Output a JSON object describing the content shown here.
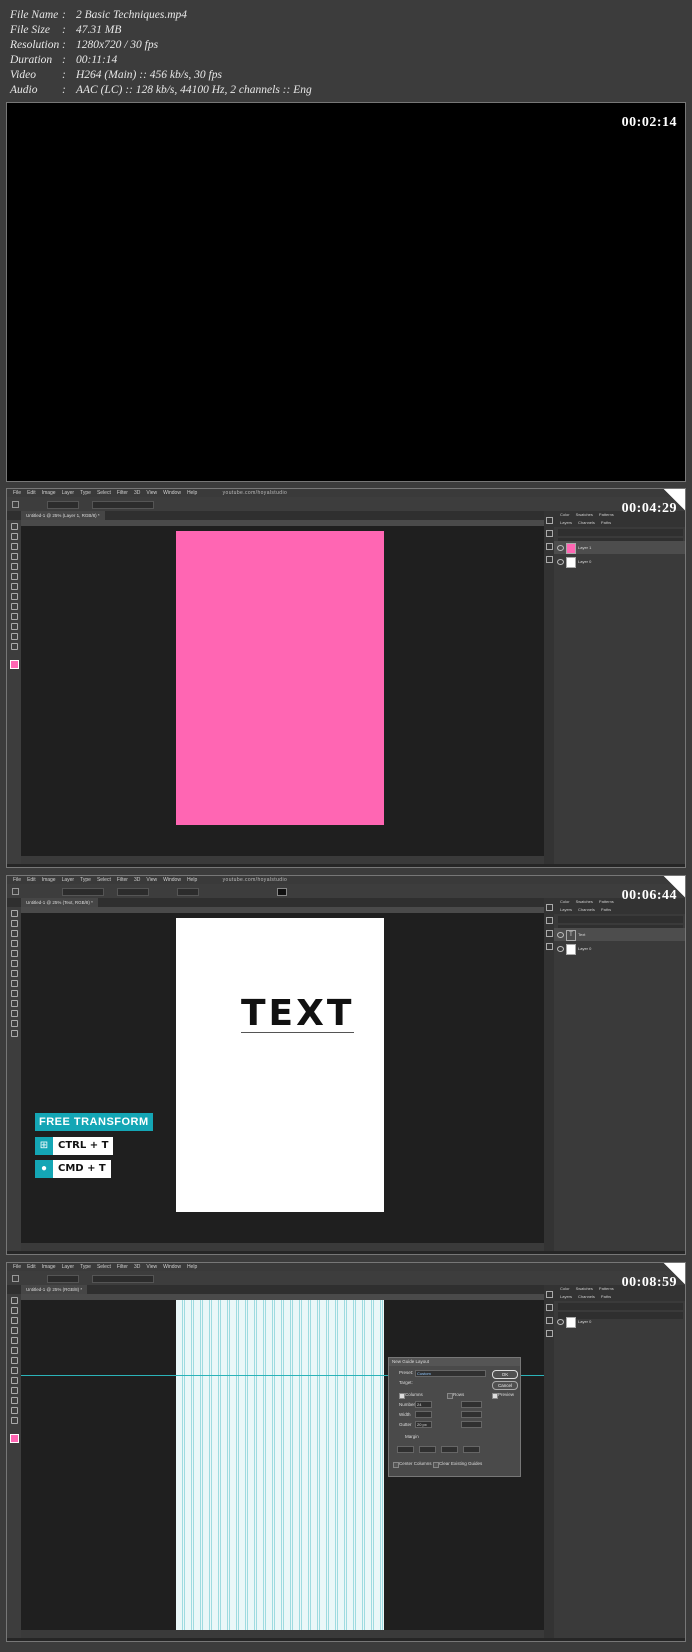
{
  "info": [
    {
      "key": "File Name",
      "value": "2 Basic Techniques.mp4"
    },
    {
      "key": "File Size",
      "value": "47.31 MB"
    },
    {
      "key": "Resolution",
      "value": "1280x720 / 30 fps"
    },
    {
      "key": "Duration",
      "value": "00:11:14"
    },
    {
      "key": "Video",
      "value": "H264 (Main) :: 456 kb/s, 30 fps"
    },
    {
      "key": "Audio",
      "value": "AAC (LC) :: 128 kb/s, 44100 Hz, 2 channels :: Eng"
    }
  ],
  "frames": [
    {
      "timestamp": "00:02:14"
    },
    {
      "timestamp": "00:04:29"
    },
    {
      "timestamp": "00:06:44"
    },
    {
      "timestamp": "00:08:59"
    }
  ],
  "ps": {
    "menu": [
      "File",
      "Edit",
      "Image",
      "Layer",
      "Type",
      "Select",
      "Filter",
      "3D",
      "View",
      "Window",
      "Help"
    ],
    "url": "youtube.com/hoyalstudio",
    "panel_tabs": [
      "Color",
      "Swatches",
      "Patterns"
    ],
    "panel_tabs2": [
      "Layers",
      "Channels",
      "Paths"
    ]
  },
  "frame2": {
    "doc_tab": "Untitled-1 @ 25% (Layer 1, RGB/8) *",
    "layers": [
      "Layer 1",
      "Layer 0"
    ],
    "canvas_color": "#ff66b3"
  },
  "frame3": {
    "doc_tab": "Untitled-1 @ 25% (Text, RGB/8) *",
    "canvas_text": "TEXT",
    "layers": [
      "Text",
      "Layer 0"
    ],
    "badge": "FREE TRANSFORM",
    "win_keys": "CTRL + T",
    "mac_keys": "CMD + T"
  },
  "frame4": {
    "doc_tab": "Untitled-1 @ 25% (RGB/8) *",
    "layers": [
      "Layer 0"
    ],
    "dialog": {
      "title": "New Guide Layout",
      "preset_label": "Preset:",
      "preset_value": "Custom",
      "target_label": "Target:",
      "ok": "OK",
      "cancel": "Cancel",
      "preview": "Preview",
      "columns": "Columns",
      "rows": "Rows",
      "number_label": "Number",
      "number_value": "24",
      "width_label": "Width",
      "gutter_label": "Gutter",
      "gutter_value": "20 px",
      "margin": "Margin",
      "center_columns": "Center Columns",
      "clear_guides": "Clear Existing Guides"
    }
  },
  "colors": {
    "accent": "#14a6b5",
    "pink": "#ff66b3"
  }
}
